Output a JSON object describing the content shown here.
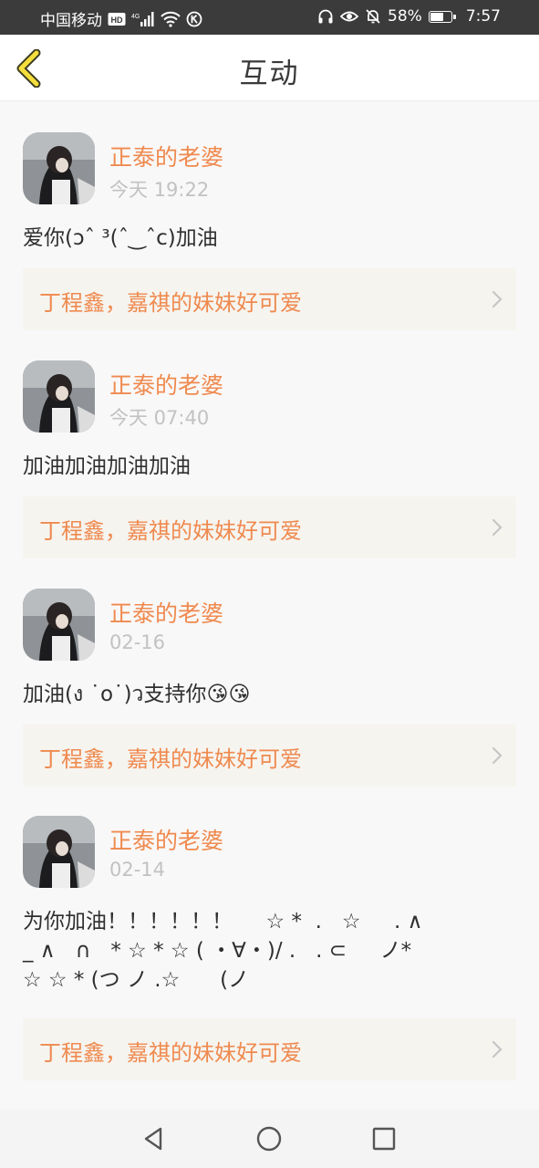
{
  "status_bar": {
    "carrier": "中国移动",
    "hd": "HD",
    "net": "4G",
    "battery": "58%",
    "battery_level": 0.58,
    "time": "7:57"
  },
  "header": {
    "title": "互动"
  },
  "posts": [
    {
      "author": "正泰的老婆",
      "time": "今天 19:22",
      "content": "爱你(ↄˆ ³(ˆ‿ˆc)加油",
      "ref": "丁程鑫，嘉祺的妹妹好可爱"
    },
    {
      "author": "正泰的老婆",
      "time": "今天 07:40",
      "content": "加油加油加油加油",
      "ref": "丁程鑫，嘉祺的妹妹好可爱"
    },
    {
      "author": "正泰的老婆",
      "time": "02-16",
      "content": "加油(ง ˙o˙)ว支持你😘😘",
      "ref": "丁程鑫，嘉祺的妹妹好可爱"
    },
    {
      "author": "正泰的老婆",
      "time": "02-14",
      "content": "为你加油！！！！！！     ☆ *  .   ☆     . ∧\n_ ∧   ∩   * ☆ * ☆ ( ・∀・)/ .   . ⊂     ノ*\n☆ ☆ * (つ ノ .☆      (ノ",
      "ref": "丁程鑫，嘉祺的妹妹好可爱"
    }
  ]
}
